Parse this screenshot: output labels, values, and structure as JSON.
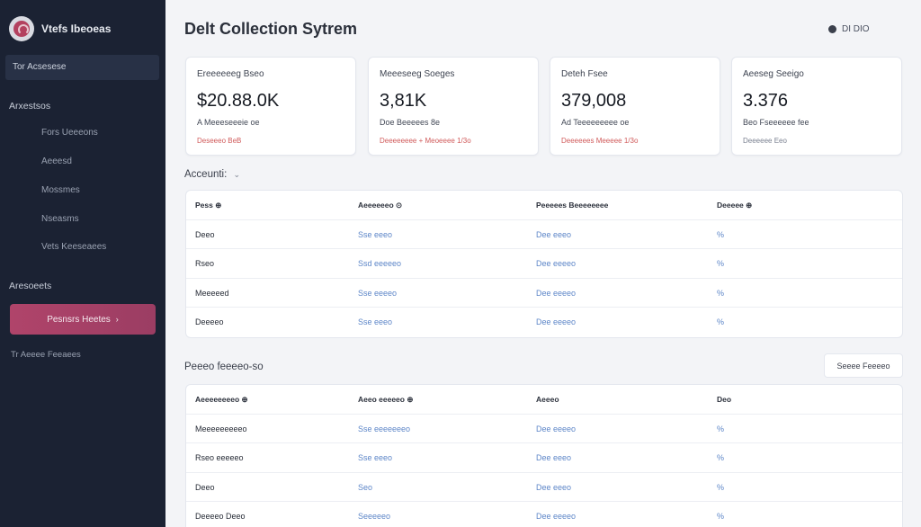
{
  "sidebar": {
    "brand": "Vtefs Ibeoeas",
    "active_item": "Tor Acsesese",
    "section1": "Arxestsos",
    "items": [
      "Fors Ueeeons",
      "Aeeesd",
      "Mossmes",
      "Nseasms",
      "Vets Keeseaees"
    ],
    "section2": "Aresoeets",
    "cta_label": "Pesnsrs Heetes",
    "cta_chevron": "›",
    "footer": "Tr Aeeee Feeaees"
  },
  "header": {
    "title": "Delt Collection Sytrem",
    "controls_text": "DI DIO"
  },
  "kpis": [
    {
      "label": "Ereeeeeeg Bseo",
      "value": "$20.88.0K",
      "sub": "A Meeeseeeie oe",
      "trend": "Deseeeo BeB",
      "trend_color": "#d05a5a"
    },
    {
      "label": "Meeeseeg Soeges",
      "value": "3,81K",
      "sub": "Doe Beeeees 8e",
      "trend": "Deeeeeeee + Meoeeee 1/3o",
      "trend_color": "#d05a5a"
    },
    {
      "label": "Deteh Fsee",
      "value": "379,008",
      "sub": "Ad Teeeeeeeee oe",
      "trend": "Deeeeees Meeeee 1/3o",
      "trend_color": "#d05a5a"
    },
    {
      "label": "Aeeseg Seeigo",
      "value": "3.376",
      "sub": "Beo Fseeeeee fee",
      "trend": "Deeeeee Eeo",
      "trend_color": "#7a8090"
    }
  ],
  "accounts": {
    "title": "Acceunti:",
    "caret": "⌄",
    "columns": [
      "Pess ⊕",
      "Aeeeeeeo ⊙",
      "Peeeees Beeeeeeee",
      "Deeeee ⊕"
    ],
    "rows": [
      [
        "Deeo",
        "Sse eeeo",
        "Dee eeeo",
        "%"
      ],
      [
        "Rseo",
        "Ssd eeeeeo",
        "Dee eeeeo",
        "%"
      ],
      [
        "Meeeeed",
        "Sse eeeeo",
        "Dee eeeeo",
        "%"
      ],
      [
        "Deeeeo",
        "Sse eeeo",
        "Dee eeeeo",
        "%"
      ]
    ]
  },
  "payments": {
    "title": "Peeeo feeeeo-so",
    "button": "Seeee Feeeeo",
    "columns": [
      "Aeeeeeeeeo ⊕",
      "Aeeo eeeeeo ⊕",
      "Aeeeo",
      "Deo"
    ],
    "rows": [
      [
        "Meeeeeeeeeo",
        "Sse eeeeeeeo",
        "Dee eeeeo",
        "%"
      ],
      [
        "Rseo eeeeeo",
        "Sse eeeo",
        "Dee eeeo",
        "%"
      ],
      [
        "Deeo",
        "Seo",
        "Dee eeeo",
        "%"
      ],
      [
        "Deeeeo Deeo",
        "Seeeeeo",
        "Dee eeeeo",
        "%"
      ]
    ]
  },
  "colors": {
    "sidebar_bg": "#1b2233",
    "accent": "#b0446a",
    "link": "#5d86c8",
    "negative": "#d05a5a"
  }
}
